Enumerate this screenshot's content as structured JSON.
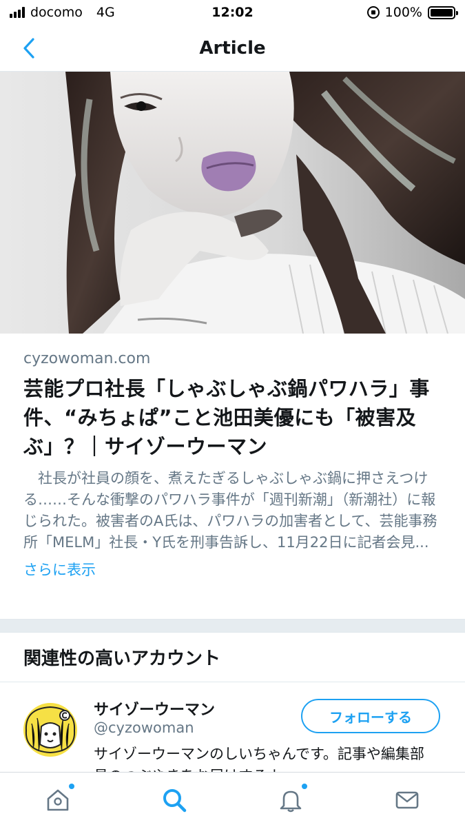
{
  "status_bar": {
    "carrier": "docomo",
    "network": "4G",
    "time": "12:02",
    "battery_percent": "100%",
    "battery_level": 1.0
  },
  "nav": {
    "title": "Article"
  },
  "article": {
    "domain": "cyzowoman.com",
    "headline": "芸能プロ社長「しゃぶしゃぶ鍋パワハラ」事件、“みちょぱ”こと池田美優にも「被害及ぶ」？｜サイゾーウーマン",
    "description": "社長が社員の顔を、煮えたぎるしゃぶしゃぶ鍋に押さえつける……そんな衝撃のパワハラ事件が「週刊新潮」（新潮社）に報じられた。被害者のA氏は、パワハラの加害者として、芸能事務所「MELM」社長・Y氏を刑事告訴し、11月22日に記者会見...",
    "more_label": "さらに表示"
  },
  "related": {
    "header": "関連性の高いアカウント",
    "account": {
      "name": "サイゾーウーマン",
      "handle": "@cyzowoman",
      "bio": "サイゾーウーマンのしいちゃんです。記事や編集部員のつぶやきをお届けするよ",
      "follow_label": "フォローする"
    }
  },
  "tab_bar": {
    "items": [
      "home-icon",
      "search-icon",
      "notifications-icon",
      "messages-icon"
    ],
    "active": "search-icon"
  },
  "colors": {
    "accent": "#1da1f2",
    "text_primary": "#14171a",
    "text_secondary": "#657786",
    "divider": "#e6ecf0"
  }
}
